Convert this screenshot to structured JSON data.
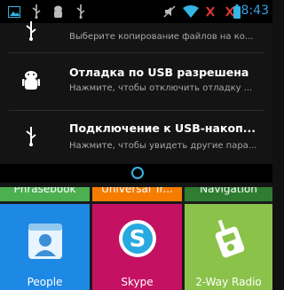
{
  "status_bar": {
    "time": "8:43",
    "icons": [
      "image-icon",
      "usb-icon",
      "android-debug-icon",
      "usb-icon",
      "muted-icon",
      "wifi-icon",
      "no-signal-icon",
      "no-signal-icon",
      "battery-icon"
    ],
    "time_color": "#3aa0e0"
  },
  "notifications": [
    {
      "icon": "usb-icon",
      "title": "",
      "subtitle": "Выберите копирование файлов на ко..."
    },
    {
      "icon": "android-debug-icon",
      "title": "Отладка по USB разрешена",
      "subtitle": "Нажмите, чтобы отключить отладку ..."
    },
    {
      "icon": "usb-icon",
      "title": "Подключение к USB-накоп...",
      "subtitle": "Нажмите, чтобы увидеть другие пара..."
    }
  ],
  "apps_top_row": [
    {
      "label": "Phrasebook",
      "color": "#4caf50"
    },
    {
      "label": "Universal Tr...",
      "color": "#f57c00"
    },
    {
      "label": "Navigation",
      "color": "#2e7d32"
    }
  ],
  "apps_bottom_row": [
    {
      "label": "People",
      "color": "#1e88e5",
      "icon": "contacts-icon"
    },
    {
      "label": "Skype",
      "color": "#c51162",
      "icon": "skype-icon"
    },
    {
      "label": "2-Way Radio",
      "color": "#8bc34a",
      "icon": "walkie-talkie-icon"
    }
  ],
  "colors": {
    "accent": "#33b5e5",
    "shade_background": "#141414"
  }
}
